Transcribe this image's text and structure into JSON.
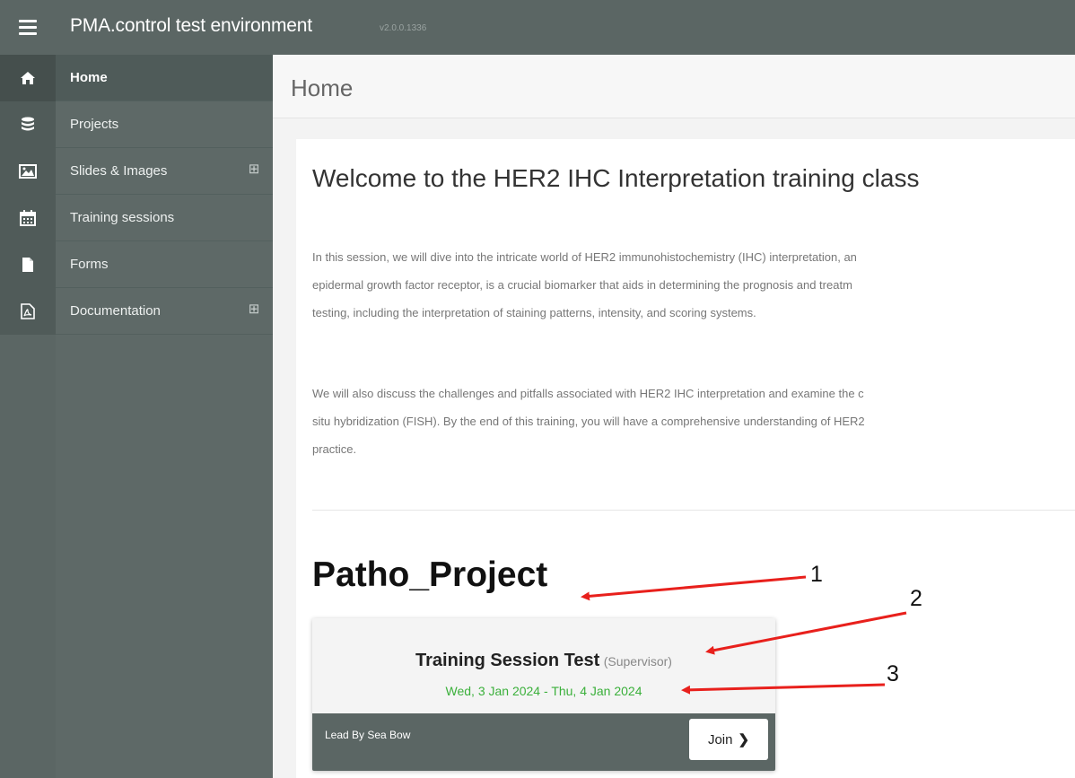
{
  "app": {
    "title": "PMA.control test environment",
    "version": "v2.0.0.1336"
  },
  "icons": {
    "menu": "hamburger-icon",
    "home": "home-icon",
    "projects": "database-icon",
    "slides": "image-icon",
    "training": "calendar-icon",
    "forms": "file-icon",
    "documentation": "pdf-icon",
    "expand": "plus-square-icon"
  },
  "sidebar": {
    "items": [
      {
        "label": "Home",
        "icon": "home-icon",
        "active": true,
        "expandable": false
      },
      {
        "label": "Projects",
        "icon": "database-icon",
        "active": false,
        "expandable": false
      },
      {
        "label": "Slides & Images",
        "icon": "image-icon",
        "active": false,
        "expandable": true
      },
      {
        "label": "Training sessions",
        "icon": "calendar-icon",
        "active": false,
        "expandable": false
      },
      {
        "label": "Forms",
        "icon": "file-icon",
        "active": false,
        "expandable": false
      },
      {
        "label": "Documentation",
        "icon": "pdf-icon",
        "active": false,
        "expandable": true
      }
    ],
    "expand_glyph": "⊞"
  },
  "page": {
    "title": "Home"
  },
  "main": {
    "welcome": "Welcome to the HER2 IHC Interpretation training class",
    "para1": [
      "In this session, we will dive into the intricate world of HER2 immunohistochemistry (IHC) interpretation, an",
      "epidermal growth factor receptor, is a crucial biomarker that aids in determining the prognosis and treatm",
      "testing, including the interpretation of staining patterns, intensity, and scoring systems."
    ],
    "para2": [
      "We will also discuss the challenges and pitfalls associated with HER2 IHC interpretation and examine the c",
      "situ hybridization (FISH). By the end of this training, you will have a comprehensive understanding of HER2",
      "practice."
    ]
  },
  "project": {
    "name": "Patho_Project",
    "session": {
      "name": "Training Session Test",
      "role": "(Supervisor)",
      "start": "Wed, 3 Jan 2024",
      "separator": "-",
      "end": "Thu, 4 Jan 2024",
      "lead_by": "Lead By Sea Bow",
      "join_label": "Join",
      "join_chevron": "❯"
    }
  },
  "annotations": [
    "1",
    "2",
    "3"
  ],
  "colors": {
    "topbar": "#5b6664",
    "sidebar": "#5e6967",
    "dates_green": "#3bb03b",
    "annotation_arrow": "#e8201c"
  }
}
